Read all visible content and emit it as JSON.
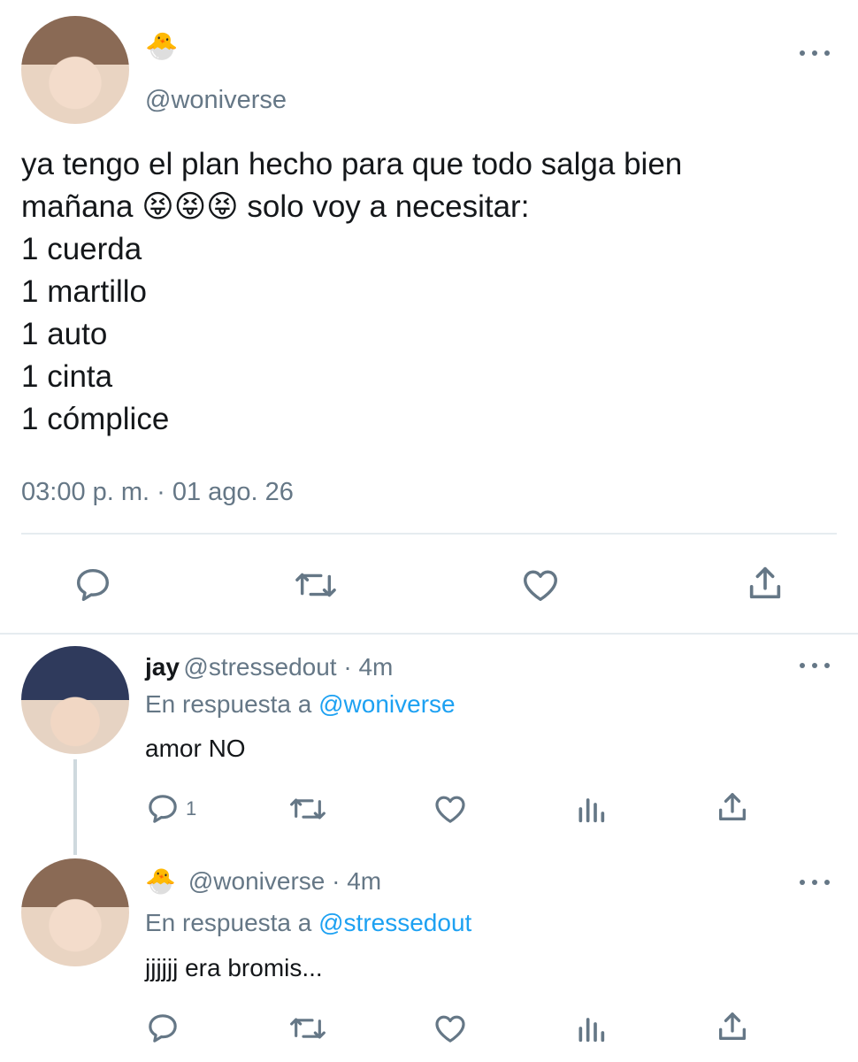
{
  "main_tweet": {
    "emoji_name": "🐣",
    "handle": "@woniverse",
    "text": "ya tengo el plan hecho para que todo salga bien\nmañana 😝😝😝  solo voy a necesitar:\n1 cuerda\n1 martillo\n1 auto\n1 cinta\n1 cómplice",
    "timestamp": "03:00 p. m. · 01 ago. 26"
  },
  "replies": [
    {
      "name": "jay",
      "handle": "@stressedout · 4m",
      "reply_prefix": "En respuesta a",
      "reply_to": "@woniverse",
      "text": "amor NO",
      "reply_count": "1"
    },
    {
      "emoji_name": "🐣",
      "handle": "@woniverse · 4m",
      "reply_prefix": "En respuesta a",
      "reply_to": "@stressedout",
      "text": "jjjjjj era bromis..."
    }
  ],
  "colors": {
    "accent": "#1da1f2",
    "muted": "#657786",
    "divider": "#e6ecf0"
  }
}
